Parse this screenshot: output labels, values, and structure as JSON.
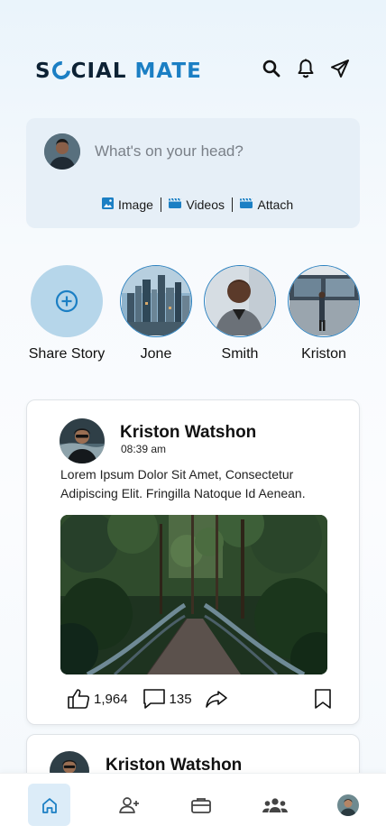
{
  "app": {
    "logo_pre": "S",
    "logo_post": "CIAL",
    "logo_accent": "MATE"
  },
  "header": {
    "icons": [
      "search-icon",
      "bell-icon",
      "send-icon"
    ]
  },
  "composer": {
    "placeholder": "What's on your head?",
    "actions": [
      {
        "label": "Image",
        "icon": "image-icon"
      },
      {
        "label": "Videos",
        "icon": "video-icon"
      },
      {
        "label": "Attach",
        "icon": "attach-icon"
      }
    ]
  },
  "stories": [
    {
      "name": "Share Story"
    },
    {
      "name": "Jone"
    },
    {
      "name": "Smith"
    },
    {
      "name": "Kriston"
    }
  ],
  "posts": [
    {
      "author": "Kriston Watshon",
      "time": "08:39 am",
      "text": "Lorem Ipsum Dolor Sit Amet, Consectetur Adipiscing Elit. Fringilla Natoque Id Aenean.",
      "likes": "1,964",
      "comments": "135"
    },
    {
      "author": "Kriston Watshon"
    }
  ],
  "nav": [
    "home-icon",
    "add-friend-icon",
    "briefcase-icon",
    "groups-icon",
    "profile-avatar"
  ],
  "colors": {
    "accent": "#1b7fc4",
    "composer_bg": "#e6eff7",
    "story_ring": "#2a80bf",
    "nav_active": "#dcecf8"
  }
}
